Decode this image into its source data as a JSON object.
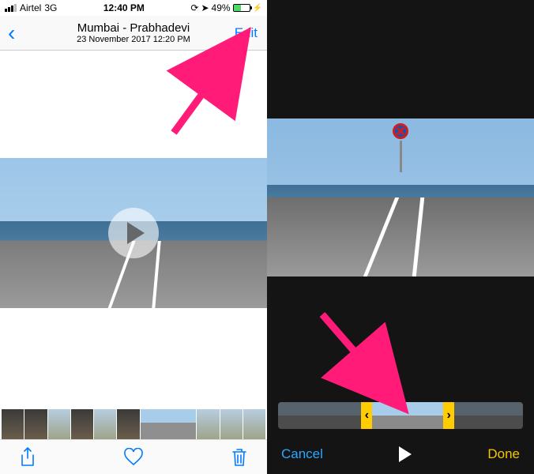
{
  "status": {
    "carrier": "Airtel",
    "network": "3G",
    "time": "12:40 PM",
    "battery_pct": "49%",
    "battery_fill": 49
  },
  "nav": {
    "title": "Mumbai - Prabhadevi",
    "subtitle": "23 November 2017  12:20 PM",
    "edit_label": "Edit"
  },
  "toolbar": {
    "share": "share-icon",
    "favorite": "heart-icon",
    "trash": "trash-icon"
  },
  "editor": {
    "cancel_label": "Cancel",
    "done_label": "Done"
  }
}
